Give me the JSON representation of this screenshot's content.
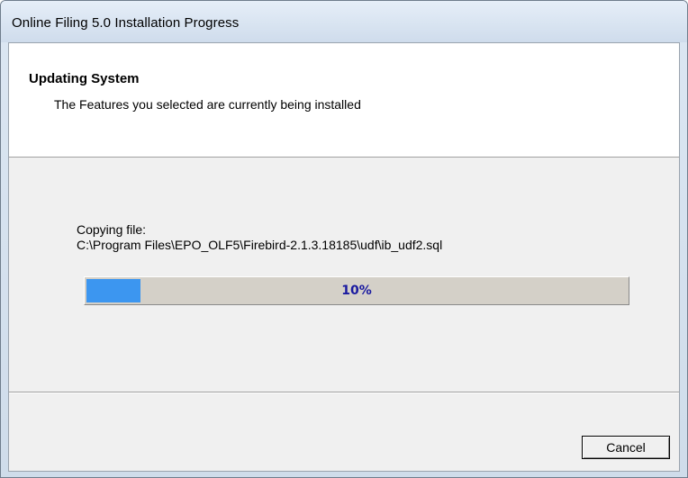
{
  "window": {
    "title": "Online Filing 5.0 Installation Progress"
  },
  "header": {
    "title": "Updating System",
    "subtitle": "The Features you selected are currently being installed"
  },
  "status": {
    "label": "Copying file:",
    "path": "C:\\Program Files\\EPO_OLF5\\Firebird-2.1.3.18185\\udf\\ib_udf2.sql"
  },
  "progress": {
    "percent": 10,
    "text": "10%",
    "fill_color": "#3c96f0"
  },
  "buttons": {
    "cancel_label": "Cancel"
  }
}
